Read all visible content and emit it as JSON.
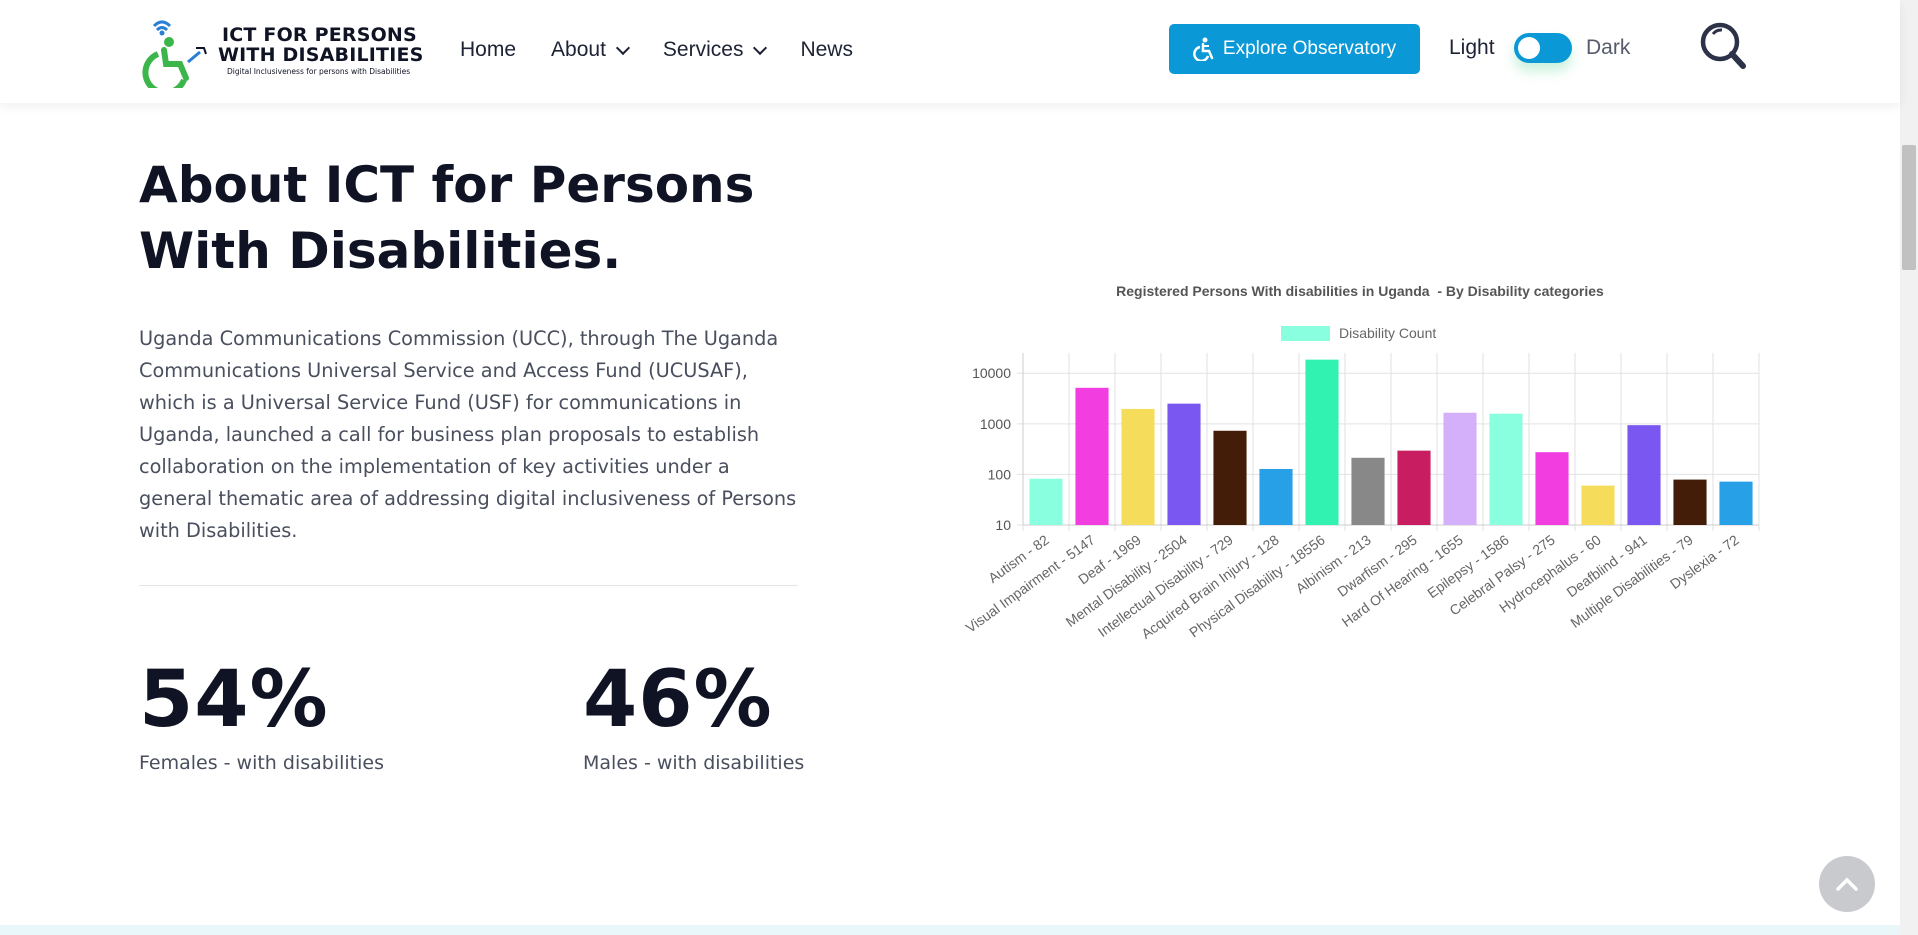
{
  "header": {
    "logo_line1": "ICT FOR PERSONS",
    "logo_line2": "WITH DISABILITIES",
    "logo_tagline": "Digital Inclusiveness for persons with Disabilities",
    "nav": [
      {
        "label": "Home",
        "has_dropdown": false
      },
      {
        "label": "About",
        "has_dropdown": true
      },
      {
        "label": "Services",
        "has_dropdown": true
      },
      {
        "label": "News",
        "has_dropdown": false
      }
    ],
    "explore_button": "Explore Observatory",
    "theme_light": "Light",
    "theme_dark": "Dark"
  },
  "about": {
    "title": "About ICT for Persons With Disabilities.",
    "paragraph": "Uganda Communications Commission (UCC), through The Uganda Communications Universal Service and Access Fund (UCUSAF), which is a Universal Service Fund (USF) for communications in Uganda, launched a call for business plan proposals to establish collaboration on the implementation of key activities under a general thematic area of addressing digital inclusiveness of Persons with Disabilities."
  },
  "stats": [
    {
      "value": "54%",
      "label": "Females - with disabilities"
    },
    {
      "value": "46%",
      "label": "Males - with disabilities"
    }
  ],
  "colors": {
    "accent": "#0b98d6",
    "text_dark": "#0f1324",
    "text_body": "#4a4f5e"
  },
  "chart_data": {
    "type": "bar",
    "title": "Registered Persons With disabilities in Uganda  - By Disability categories",
    "legend": [
      "Disability Count"
    ],
    "legend_color": "#8affdf",
    "y_scale": "log",
    "ylim": [
      10,
      20000
    ],
    "y_ticks": [
      "10",
      "100",
      "1000",
      "10000"
    ],
    "grid": true,
    "categories": [
      "Autism - 82",
      "Visual Impairment - 5147",
      "Deaf - 1969",
      "Mental Disability - 2504",
      "Intellectual Disability - 729",
      "Acquired Brain Injury - 128",
      "Physical Disability - 18556",
      "Albinism - 213",
      "Dwarfism - 295",
      "Hard Of Hearing - 1655",
      "Epilepsy - 1586",
      "Celebral Palsy - 275",
      "Hydrocephalus - 60",
      "Deafblind - 941",
      "Multiple Disabilities - 79",
      "Dyslexia - 72"
    ],
    "values": [
      82,
      5147,
      1969,
      2504,
      729,
      128,
      18556,
      213,
      295,
      1655,
      1586,
      275,
      60,
      941,
      79,
      72
    ],
    "bar_colors": [
      "#8affdf",
      "#f23ee0",
      "#f5dc5a",
      "#7b57f1",
      "#431d08",
      "#27a0e8",
      "#31f2b0",
      "#888888",
      "#c91d61",
      "#d4b0fa",
      "#8affdf",
      "#f23ee0",
      "#f5dc5a",
      "#7b57f1",
      "#431d08",
      "#27a0e8"
    ]
  }
}
